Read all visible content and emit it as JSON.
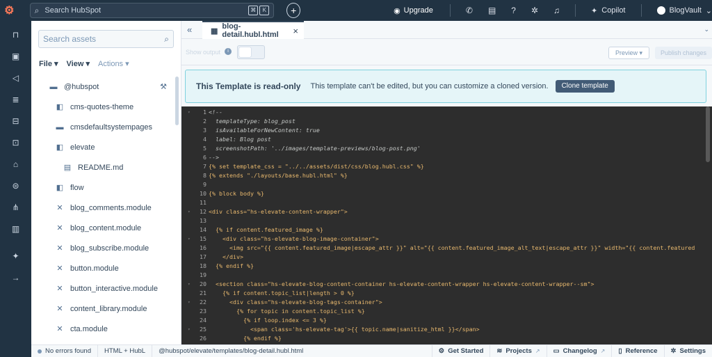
{
  "topnav": {
    "logo_icon": "hubspot-logo-icon",
    "search_placeholder": "Search HubSpot",
    "shortcut_keys": [
      "⌘",
      "K"
    ],
    "upgrade_label": "Upgrade",
    "copilot_label": "Copilot",
    "account_label": "BlogVault"
  },
  "assets": {
    "search_placeholder": "Search assets",
    "menu": [
      {
        "label": "File",
        "dim": false
      },
      {
        "label": "View",
        "dim": false
      },
      {
        "label": "Actions",
        "dim": true
      }
    ],
    "items": [
      {
        "label": "@hubspot",
        "icon": "folder-icon",
        "indent": 1
      },
      {
        "label": "cms-quotes-theme",
        "icon": "theme-folder-icon",
        "indent": 2
      },
      {
        "label": "cmsdefaultsystempages",
        "icon": "folder-icon",
        "indent": 2
      },
      {
        "label": "elevate",
        "icon": "theme-folder-icon",
        "indent": 2
      },
      {
        "label": "README.md",
        "icon": "document-icon",
        "indent": 3
      },
      {
        "label": "flow",
        "icon": "theme-folder-icon",
        "indent": 2
      },
      {
        "label": "blog_comments.module",
        "icon": "module-icon",
        "indent": 2
      },
      {
        "label": "blog_content.module",
        "icon": "module-icon",
        "indent": 2
      },
      {
        "label": "blog_subscribe.module",
        "icon": "module-icon",
        "indent": 2
      },
      {
        "label": "button.module",
        "icon": "module-icon",
        "indent": 2
      },
      {
        "label": "button_interactive.module",
        "icon": "module-icon",
        "indent": 2
      },
      {
        "label": "content_library.module",
        "icon": "module-icon",
        "indent": 2
      },
      {
        "label": "cta.module",
        "icon": "module-icon",
        "indent": 2
      }
    ]
  },
  "editor": {
    "tab_label": "blog-detail.hubl.html",
    "dev_label": "Show output",
    "preview_label": "Preview ▾",
    "publish_label": "Publish changes",
    "banner_title": "This Template is read-only",
    "banner_message": "This template can't be edited, but you can customize a cloned version.",
    "clone_label": "Clone template",
    "code_lines": [
      {
        "n": "1",
        "fold": true,
        "kind": "comment",
        "text": "<!--"
      },
      {
        "n": "2",
        "fold": false,
        "kind": "comment",
        "text": "  templateType: blog_post"
      },
      {
        "n": "3",
        "fold": false,
        "kind": "comment",
        "text": "  isAvailableForNewContent: true"
      },
      {
        "n": "4",
        "fold": false,
        "kind": "comment",
        "text": "  label: Blog post"
      },
      {
        "n": "5",
        "fold": false,
        "kind": "comment",
        "text": "  screenshotPath: '../images/template-previews/blog-post.png'"
      },
      {
        "n": "6",
        "fold": false,
        "kind": "comment",
        "text": "-->"
      },
      {
        "n": "7",
        "fold": false,
        "kind": "hubl",
        "text": "{% set template_css = \"../../assets/dist/css/blog.hubl.css\" %}"
      },
      {
        "n": "8",
        "fold": false,
        "kind": "hubl",
        "text": "{% extends \"./layouts/base.hubl.html\" %}"
      },
      {
        "n": "9",
        "fold": false,
        "kind": "hubl",
        "text": ""
      },
      {
        "n": "10",
        "fold": false,
        "kind": "hubl",
        "text": "{% block body %}"
      },
      {
        "n": "11",
        "fold": false,
        "kind": "hubl",
        "text": ""
      },
      {
        "n": "12",
        "fold": true,
        "kind": "tag",
        "text": "<div class=\"hs-elevate-content-wrapper\">"
      },
      {
        "n": "13",
        "fold": false,
        "kind": "tag",
        "text": ""
      },
      {
        "n": "14",
        "fold": false,
        "kind": "hubl",
        "text": "  {% if content.featured_image %}"
      },
      {
        "n": "15",
        "fold": true,
        "kind": "tag",
        "text": "    <div class=\"hs-elevate-blog-image-container\">"
      },
      {
        "n": "16",
        "fold": false,
        "kind": "tag",
        "text": "      <img src=\"{{ content.featured_image|escape_attr }}\" alt=\"{{ content.featured_image_alt_text|escape_attr }}\" width=\"{{ content.featured"
      },
      {
        "n": "17",
        "fold": false,
        "kind": "tag",
        "text": "    </div>"
      },
      {
        "n": "18",
        "fold": false,
        "kind": "hubl",
        "text": "  {% endif %}"
      },
      {
        "n": "19",
        "fold": false,
        "kind": "tag",
        "text": ""
      },
      {
        "n": "20",
        "fold": true,
        "kind": "tag",
        "text": "  <section class=\"hs-elevate-blog-content-container hs-elevate-content-wrapper hs-elevate-content-wrapper--sm\">"
      },
      {
        "n": "21",
        "fold": false,
        "kind": "hubl",
        "text": "    {% if content.topic_list|length > 0 %}"
      },
      {
        "n": "22",
        "fold": true,
        "kind": "tag",
        "text": "      <div class=\"hs-elevate-blog-tags-container\">"
      },
      {
        "n": "23",
        "fold": false,
        "kind": "hubl",
        "text": "        {% for topic in content.topic_list %}"
      },
      {
        "n": "24",
        "fold": false,
        "kind": "hubl",
        "text": "          {% if loop.index <= 3 %}"
      },
      {
        "n": "25",
        "fold": true,
        "kind": "tag",
        "text": "            <span class='hs-elevate-tag'>{{ topic.name|sanitize_html }}</span>"
      },
      {
        "n": "26",
        "fold": false,
        "kind": "hubl",
        "text": "          {% endif %}"
      }
    ]
  },
  "status": {
    "errors_label": "No errors found",
    "language_label": "HTML + HubL",
    "path_label": "@hubspot/elevate/templates/blog-detail.hubl.html",
    "links": [
      {
        "label": "Get Started",
        "icon": "hubspot-sprocket-icon",
        "external": false
      },
      {
        "label": "Projects",
        "icon": "layers-icon",
        "external": true
      },
      {
        "label": "Changelog",
        "icon": "changelog-icon",
        "external": true
      },
      {
        "label": "Reference",
        "icon": "book-icon",
        "external": false
      },
      {
        "label": "Settings",
        "icon": "gear-icon",
        "external": false
      }
    ]
  }
}
